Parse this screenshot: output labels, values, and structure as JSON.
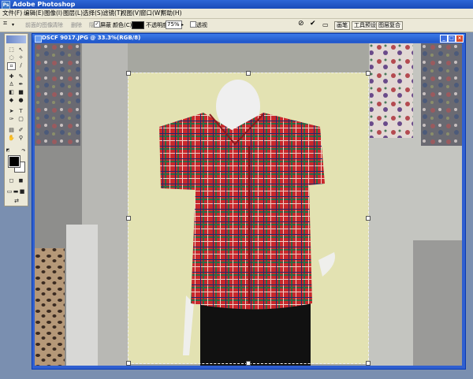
{
  "app": {
    "title": "Adobe Photoshop",
    "icon": "ps-icon"
  },
  "menu": [
    "文件(F)",
    "编辑(E)",
    "图像(I)",
    "图层(L)",
    "选择(S)",
    "滤镜(T)",
    "视图(V)",
    "窗口(W)",
    "帮助(H)"
  ],
  "options": {
    "tool_icon": "crop-icon",
    "front_image_label": "前面的图像",
    "clear_label": "清除",
    "delete_label": "删除",
    "hide_label": "隐藏",
    "shield_label": "屏蔽",
    "shield_checked": true,
    "color_label": "颜色(C):",
    "opacity_label": "不透明度:",
    "opacity_value": "75%",
    "perspective_label": "透视",
    "perspective_checked": false,
    "cancel_icon": "cancel-icon",
    "commit_icon": "check-icon"
  },
  "palette_tabs": [
    "画笔",
    "工具预设",
    "图层复合"
  ],
  "document": {
    "title": "DSCF 9017.JPG @ 33.3%(RGB/8)",
    "colors": {
      "foreground": "#000000",
      "background": "#ffffff"
    }
  }
}
